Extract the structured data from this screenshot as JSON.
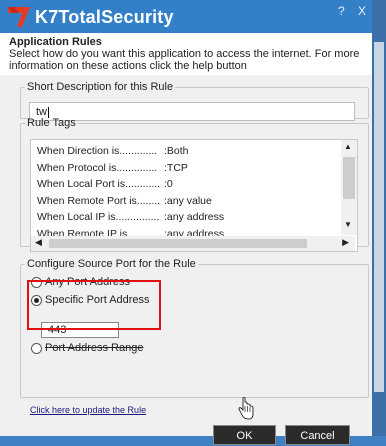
{
  "window": {
    "brand": "K7TotalSecurity",
    "help_btn": "?",
    "close_btn": "X"
  },
  "header": {
    "title": "Application Rules",
    "description": "Select how do you want this application to access the internet. For more information on these actions click the help button"
  },
  "short_description": {
    "legend": "Short Description for this Rule",
    "value": "tw"
  },
  "rule_tags": {
    "legend": "Rule Tags",
    "rows": [
      {
        "key": "When Direction is.............",
        "value": ":Both"
      },
      {
        "key": "When Protocol is..............",
        "value": ":TCP"
      },
      {
        "key": "When Local Port is............",
        "value": ":0"
      },
      {
        "key": "When Remote Port is........",
        "value": ":any value"
      },
      {
        "key": "When Local IP is...............",
        "value": ":any address"
      },
      {
        "key": "When Remote IP is.............",
        "value": ":any address"
      }
    ]
  },
  "source_port": {
    "legend": "Configure Source Port for the Rule",
    "options": [
      "Any Port Address",
      "Specific Port Address",
      "Port Address Range"
    ],
    "selected": "Specific Port Address",
    "port_value": "443"
  },
  "help_link": "Click here to update the Rule",
  "buttons": {
    "ok": "OK",
    "cancel": "Cancel"
  },
  "colors": {
    "titlebar": "#3380c8",
    "highlight": "#e01010",
    "button_bg": "#2b2b2b"
  }
}
